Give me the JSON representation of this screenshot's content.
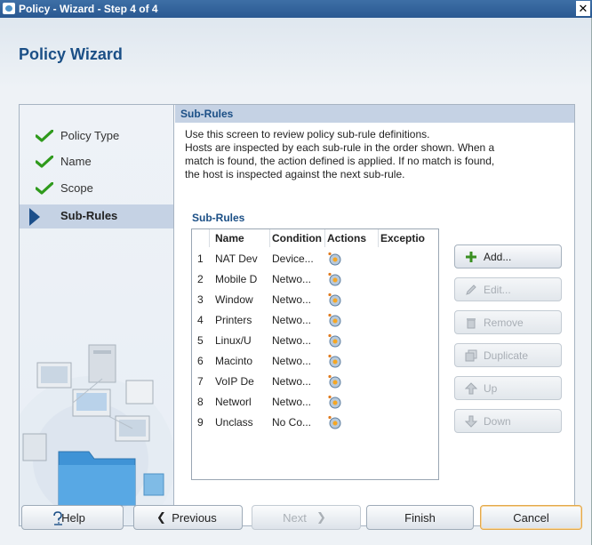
{
  "window": {
    "title": "Policy - Wizard - Step 4 of 4",
    "close_glyph": "✕"
  },
  "wizard": {
    "heading": "Policy Wizard"
  },
  "steps": [
    {
      "label": "Policy Type",
      "state": "done"
    },
    {
      "label": "Name",
      "state": "done"
    },
    {
      "label": "Scope",
      "state": "done"
    },
    {
      "label": "Sub-Rules",
      "state": "active"
    }
  ],
  "content": {
    "header": "Sub-Rules",
    "description_lines": [
      "Use this screen to review policy sub-rule definitions.",
      "Hosts are inspected by each sub-rule in the order shown. When a",
      "match is found, the action defined is applied. If no match is found,",
      "the host is inspected against the next sub-rule."
    ],
    "table_label": "Sub-Rules"
  },
  "table": {
    "columns": [
      "Name",
      "Condition",
      "Actions",
      "Exceptio"
    ],
    "rows": [
      {
        "index": "1",
        "name": "NAT Dev",
        "condition": "Device...",
        "has_action_icon": true
      },
      {
        "index": "2",
        "name": "Mobile D",
        "condition": "Netwo...",
        "has_action_icon": true
      },
      {
        "index": "3",
        "name": "Window",
        "condition": "Netwo...",
        "has_action_icon": true
      },
      {
        "index": "4",
        "name": "Printers",
        "condition": "Netwo...",
        "has_action_icon": true
      },
      {
        "index": "5",
        "name": "Linux/U",
        "condition": "Netwo...",
        "has_action_icon": true
      },
      {
        "index": "6",
        "name": "Macinto",
        "condition": "Netwo...",
        "has_action_icon": true
      },
      {
        "index": "7",
        "name": "VoIP De",
        "condition": "Netwo...",
        "has_action_icon": true
      },
      {
        "index": "8",
        "name": "Networl",
        "condition": "Netwo...",
        "has_action_icon": true
      },
      {
        "index": "9",
        "name": "Unclass",
        "condition": "No Co...",
        "has_action_icon": true
      }
    ]
  },
  "side_buttons": [
    {
      "label": "Add...",
      "icon": "plus-icon",
      "enabled": true
    },
    {
      "label": "Edit...",
      "icon": "pencil-icon",
      "enabled": false
    },
    {
      "label": "Remove",
      "icon": "trash-icon",
      "enabled": false
    },
    {
      "label": "Duplicate",
      "icon": "duplicate-icon",
      "enabled": false
    },
    {
      "label": "Up",
      "icon": "up-arrow-icon",
      "enabled": false
    },
    {
      "label": "Down",
      "icon": "down-arrow-icon",
      "enabled": false
    }
  ],
  "footer": {
    "help": "Help",
    "previous": "Previous",
    "next": "Next",
    "finish": "Finish",
    "cancel": "Cancel"
  },
  "colors": {
    "accent": "#1b4f86",
    "titlebar": "#2a5891",
    "check": "#2f9a1c",
    "cancel_border": "#e3a94c"
  }
}
